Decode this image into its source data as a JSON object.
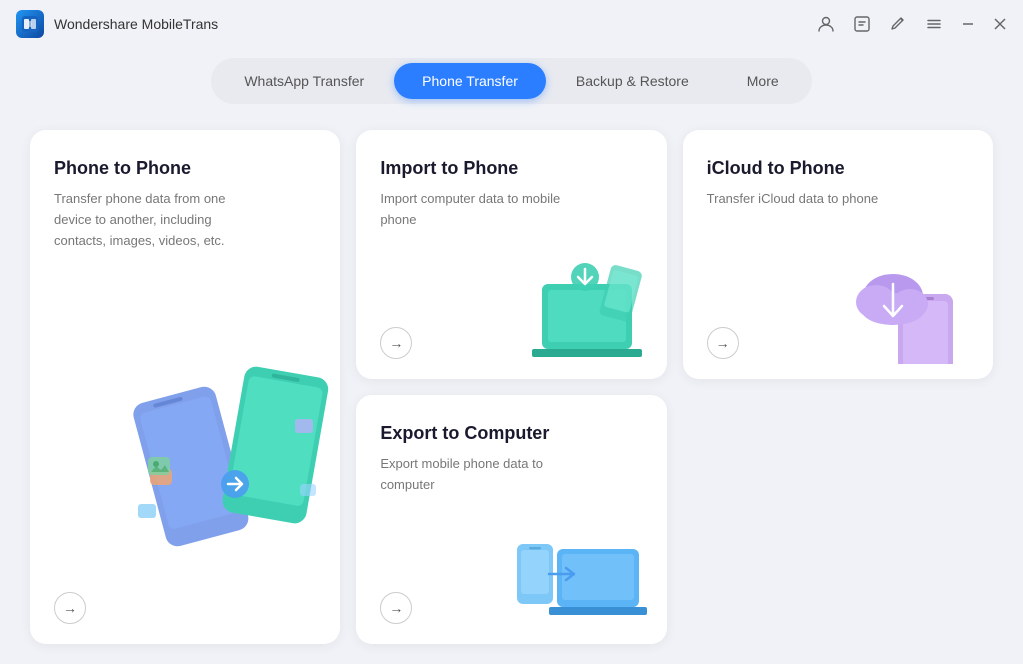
{
  "app": {
    "title": "Wondershare MobileTrans",
    "icon_label": "MT"
  },
  "titlebar": {
    "icons": [
      "account",
      "notification",
      "edit",
      "menu",
      "minimize",
      "close"
    ]
  },
  "nav": {
    "tabs": [
      {
        "id": "whatsapp",
        "label": "WhatsApp Transfer",
        "active": false
      },
      {
        "id": "phone",
        "label": "Phone Transfer",
        "active": true
      },
      {
        "id": "backup",
        "label": "Backup & Restore",
        "active": false
      },
      {
        "id": "more",
        "label": "More",
        "active": false
      }
    ]
  },
  "cards": [
    {
      "id": "phone-to-phone",
      "title": "Phone to Phone",
      "description": "Transfer phone data from one device to another, including contacts, images, videos, etc.",
      "large": true
    },
    {
      "id": "import-to-phone",
      "title": "Import to Phone",
      "description": "Import computer data to mobile phone",
      "large": false
    },
    {
      "id": "icloud-to-phone",
      "title": "iCloud to Phone",
      "description": "Transfer iCloud data to phone",
      "large": false
    },
    {
      "id": "export-to-computer",
      "title": "Export to Computer",
      "description": "Export mobile phone data to computer",
      "large": false
    }
  ],
  "arrow_label": "→"
}
